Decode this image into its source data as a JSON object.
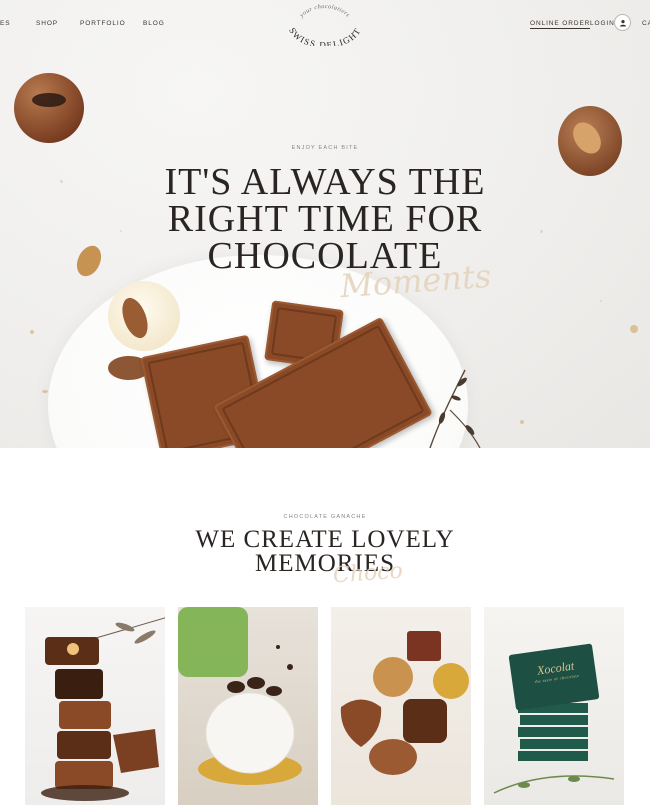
{
  "nav": {
    "items": [
      "ES",
      "SHOP",
      "PORTFOLIO",
      "BLOG"
    ],
    "online_order": "ONLINE ORDER",
    "login": "LOGIN",
    "cart_partial": "CA"
  },
  "logo": {
    "tagline": "your chocolatiers",
    "name": "SWISS DELIGHT"
  },
  "hero": {
    "eyebrow": "ENJOY EACH BITE",
    "title_line1": "IT'S ALWAYS THE",
    "title_line2": "RIGHT TIME FOR",
    "title_line3": "CHOCOLATE",
    "script": "Moments"
  },
  "section": {
    "eyebrow": "CHOCOLATE GANACHE",
    "title_line1": "WE CREATE LOVELY",
    "title_line2": "MEMORIES",
    "script": "Choco"
  },
  "gallery": [
    {
      "name": "stacked-cups"
    },
    {
      "name": "dome-cake"
    },
    {
      "name": "assorted-pralines"
    },
    {
      "name": "xocolat-bars",
      "brand": "Xocolat",
      "sub": "the taste of chocolate"
    }
  ],
  "colors": {
    "accent": "#e4d2bb",
    "text": "#2a2522",
    "chocolate": "#8a4a27"
  }
}
